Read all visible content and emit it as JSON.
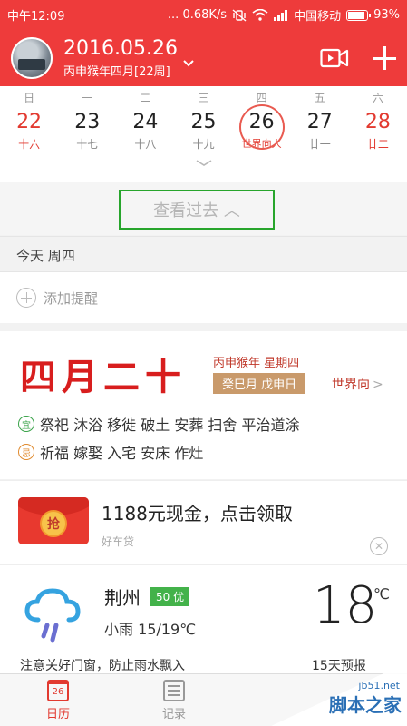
{
  "status_bar": {
    "time": "中午12:09",
    "speed": "... 0.68K/s",
    "carrier": "中国移动",
    "battery": "93%"
  },
  "header": {
    "date": "2016.05.26",
    "lunar_sub": "丙申猴年四月[22周]"
  },
  "week": {
    "weekdays": [
      "日",
      "一",
      "二",
      "三",
      "四",
      "五",
      "六"
    ],
    "days": [
      {
        "num": "22",
        "lunar": "十六"
      },
      {
        "num": "23",
        "lunar": "十七"
      },
      {
        "num": "24",
        "lunar": "十八"
      },
      {
        "num": "25",
        "lunar": "十九"
      },
      {
        "num": "26",
        "lunar": "世界向人"
      },
      {
        "num": "27",
        "lunar": "廿一"
      },
      {
        "num": "28",
        "lunar": "廿二"
      }
    ]
  },
  "past_button": {
    "label": "查看过去 ︿"
  },
  "section": {
    "today": "今天 周四"
  },
  "reminder": {
    "label": "添加提醒"
  },
  "almanac": {
    "lunar_date": "四月二十",
    "year_week": "丙申猴年  星期四",
    "ganzhi": "癸巳月  戊申日",
    "festival": "世界向",
    "yi_tag": "宜",
    "yi": "祭祀 沐浴 移徙 破土 安葬 扫舍 平治道涂",
    "ji_tag": "忌",
    "ji": "祈福 嫁娶 入宅 安床 作灶"
  },
  "ad": {
    "coin": "抢",
    "title": "1188元现金，点击领取",
    "source": "好车贷",
    "close": "✕"
  },
  "weather": {
    "city": "荆州",
    "aqi": "50 优",
    "condition": "小雨 15/19℃",
    "temperature": "18",
    "unit": "℃",
    "tip": "注意关好门窗，防止雨水飘入",
    "forecast": "15天预报"
  },
  "tabs": [
    {
      "label": "日历",
      "icon_text": "26"
    },
    {
      "label": "记录"
    }
  ],
  "watermark": {
    "url": "jb51.net",
    "name": "脚本之家"
  },
  "colors": {
    "brand_red": "#ee3b3b",
    "highlight_green": "#27a52c",
    "yi_green": "#3aa34a",
    "ji_orange": "#e08a2e"
  }
}
